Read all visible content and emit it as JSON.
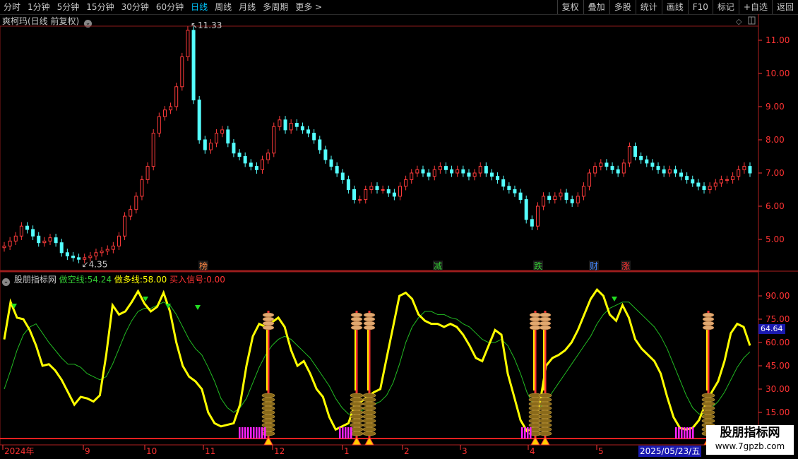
{
  "toolbar": {
    "left": [
      "分时",
      "1分钟",
      "5分钟",
      "15分钟",
      "30分钟",
      "60分钟",
      "日线",
      "周线",
      "月线",
      "多周期",
      "更多 >"
    ],
    "right": [
      "复权",
      "叠加",
      "多股",
      "统计",
      "画线",
      "F10",
      "标记",
      "+自选",
      "返回"
    ]
  },
  "stock": {
    "title": "爽柯玛(日线 前复权)",
    "high_label": "11.33",
    "low_label": "4.35"
  },
  "price_axis": [
    "11.00",
    "10.00",
    "9.00",
    "8.00",
    "7.00",
    "6.00",
    "5.00"
  ],
  "event_tags": [
    "榜",
    "减",
    "跌",
    "财",
    "涨"
  ],
  "indicator": {
    "name": "股朋指标网",
    "kong_label": "做空线:",
    "kong_value": "54.24",
    "duo_label": "做多线:",
    "duo_value": "58.00",
    "buy_label": "买入信号:",
    "buy_value": "0.00",
    "axis": [
      "90.00",
      "75.00",
      "60.00",
      "45.00",
      "30.00",
      "15.00"
    ],
    "current": "64.64"
  },
  "time_axis": [
    "2024年",
    "9",
    "10",
    "11",
    "12",
    "1",
    "2",
    "3",
    "4",
    "5"
  ],
  "date_box": "2025/05/23/五",
  "watermark": {
    "name": "股朋指标网",
    "url": "www.7gpzb.com"
  },
  "colors": {
    "up": "#ff3b3b",
    "down": "#54ffff",
    "kong": "#ffff00",
    "duo": "#22bb22",
    "axis": "#ff3333"
  },
  "chart_data": [
    {
      "type": "candlestick",
      "ylim": [
        4.3,
        11.6
      ],
      "series": [
        {
          "values": [
            4.8,
            4.95,
            5.1,
            5.4,
            5.3,
            5.1,
            4.9,
            4.95,
            5.05,
            4.9,
            4.6,
            4.5,
            4.45,
            4.4,
            4.45,
            4.5,
            4.6,
            4.65,
            4.7,
            4.8,
            5.1,
            5.7,
            5.9,
            6.3,
            6.8,
            7.2,
            8.2,
            8.7,
            8.9,
            9.0,
            9.6,
            10.5,
            11.3,
            9.2,
            8.0,
            7.7,
            7.9,
            8.2,
            8.3,
            7.9,
            7.6,
            7.5,
            7.3,
            7.2,
            7.1,
            7.4,
            7.6,
            8.4,
            8.6,
            8.3,
            8.5,
            8.4,
            8.3,
            8.2,
            8.0,
            7.7,
            7.4,
            7.2,
            7.0,
            6.8,
            6.5,
            6.2,
            6.2,
            6.5,
            6.6,
            6.5,
            6.5,
            6.4,
            6.3,
            6.6,
            6.8,
            7.0,
            7.1,
            7.0,
            6.9,
            7.1,
            7.2,
            7.1,
            7.0,
            7.1,
            7.0,
            6.9,
            7.0,
            7.2,
            7.0,
            6.9,
            6.8,
            6.6,
            6.5,
            6.4,
            6.2,
            5.6,
            5.4,
            6.0,
            6.3,
            6.2,
            6.3,
            6.4,
            6.2,
            6.1,
            6.3,
            6.6,
            7.0,
            7.2,
            7.3,
            7.2,
            7.1,
            7.0,
            7.3,
            7.8,
            7.5,
            7.4,
            7.3,
            7.2,
            7.1,
            7.0,
            7.1,
            7.0,
            6.9,
            6.8,
            6.7,
            6.6,
            6.5,
            6.6,
            6.7,
            6.8,
            6.8,
            6.9,
            7.1,
            7.2,
            7.0
          ]
        }
      ]
    },
    {
      "type": "line",
      "ylim": [
        5,
        100
      ],
      "series": [
        {
          "name": "做空线",
          "values": [
            62,
            86,
            76,
            75,
            68,
            58,
            45,
            46,
            42,
            36,
            28,
            20,
            25,
            24,
            22,
            26,
            52,
            84,
            78,
            80,
            86,
            93,
            85,
            80,
            83,
            92,
            80,
            60,
            45,
            38,
            35,
            30,
            15,
            8,
            6,
            7,
            8,
            20,
            45,
            64,
            72,
            70,
            73,
            76,
            70,
            55,
            45,
            48,
            40,
            30,
            25,
            12,
            4,
            6,
            8,
            20,
            22,
            25,
            28,
            30,
            50,
            70,
            90,
            92,
            88,
            78,
            74,
            72,
            72,
            70,
            72,
            70,
            65,
            58,
            50,
            48,
            58,
            68,
            65,
            40,
            25,
            10,
            3,
            5,
            20,
            45,
            50,
            52,
            55,
            60,
            68,
            78,
            88,
            94,
            90,
            78,
            74,
            84,
            76,
            62,
            56,
            52,
            48,
            40,
            25,
            12,
            5,
            4,
            5,
            10,
            20,
            28,
            35,
            48,
            66,
            72,
            70,
            58
          ]
        },
        {
          "name": "做多线",
          "values": [
            30,
            42,
            55,
            65,
            70,
            72,
            66,
            60,
            55,
            50,
            46,
            46,
            44,
            40,
            38,
            36,
            38,
            46,
            56,
            66,
            74,
            80,
            82,
            82,
            84,
            86,
            84,
            78,
            70,
            62,
            56,
            52,
            44,
            35,
            24,
            18,
            15,
            18,
            24,
            34,
            44,
            52,
            58,
            62,
            64,
            62,
            58,
            54,
            50,
            44,
            38,
            32,
            24,
            18,
            14,
            14,
            16,
            18,
            20,
            22,
            26,
            34,
            46,
            60,
            70,
            76,
            80,
            80,
            78,
            78,
            76,
            75,
            72,
            70,
            66,
            62,
            60,
            60,
            62,
            58,
            50,
            40,
            28,
            20,
            18,
            22,
            28,
            34,
            40,
            46,
            52,
            58,
            64,
            72,
            78,
            82,
            84,
            86,
            86,
            82,
            78,
            74,
            70,
            64,
            56,
            46,
            36,
            26,
            18,
            14,
            14,
            18,
            22,
            28,
            36,
            44,
            50,
            54
          ]
        }
      ]
    }
  ]
}
